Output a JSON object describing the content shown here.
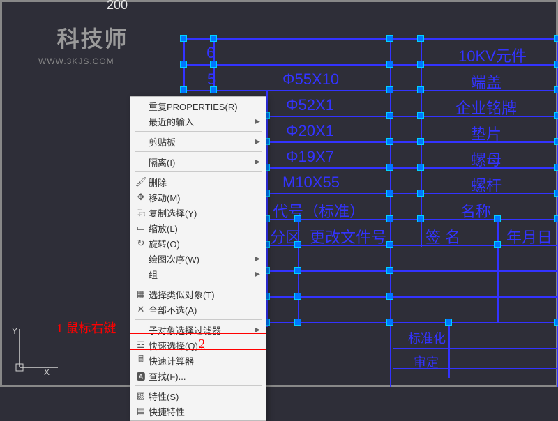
{
  "watermark": {
    "logo": "科技师",
    "url": "WWW.3KJS.COM"
  },
  "top_tick": "200",
  "menu": {
    "items": [
      {
        "label": "重复PROPERTIES(R)",
        "icon": "",
        "sub": false
      },
      {
        "label": "最近的输入",
        "icon": "",
        "sub": true
      },
      {
        "sep": true
      },
      {
        "label": "剪贴板",
        "icon": "",
        "sub": true
      },
      {
        "sep": true
      },
      {
        "label": "隔离(I)",
        "icon": "",
        "sub": true
      },
      {
        "sep": true
      },
      {
        "label": "删除",
        "icon": "erase",
        "sub": false
      },
      {
        "label": "移动(M)",
        "icon": "move",
        "sub": false
      },
      {
        "label": "复制选择(Y)",
        "icon": "copy",
        "sub": false
      },
      {
        "label": "缩放(L)",
        "icon": "scale",
        "sub": false
      },
      {
        "label": "旋转(O)",
        "icon": "rotate",
        "sub": false
      },
      {
        "label": "绘图次序(W)",
        "icon": "",
        "sub": true
      },
      {
        "label": "组",
        "icon": "",
        "sub": true
      },
      {
        "sep": true
      },
      {
        "label": "选择类似对象(T)",
        "icon": "selsim",
        "sub": false
      },
      {
        "label": "全部不选(A)",
        "icon": "desel",
        "sub": false
      },
      {
        "sep": true
      },
      {
        "label": "子对象选择过滤器",
        "icon": "",
        "sub": true
      },
      {
        "label": "快速选择(Q)...",
        "icon": "qsel",
        "sub": false
      },
      {
        "label": "快速计算器",
        "icon": "calc",
        "sub": false
      },
      {
        "label": "查找(F)...",
        "icon": "find",
        "sub": false
      },
      {
        "sep": true
      },
      {
        "label": "特性(S)",
        "icon": "prop",
        "sub": false
      },
      {
        "label": "快捷特性",
        "icon": "qprop",
        "sub": false
      }
    ]
  },
  "table": {
    "rows": [
      {
        "c1": "6",
        "c2": "",
        "c3": "10KV元件"
      },
      {
        "c1": "5",
        "c2": "Φ55X10",
        "c3": "端盖"
      },
      {
        "c1": "",
        "c2": "Φ52X1",
        "c3": "企业铭牌"
      },
      {
        "c1": "",
        "c2": "Φ20X1",
        "c3": "垫片"
      },
      {
        "c1": "",
        "c2": "Φ19X7",
        "c3": "螺母"
      },
      {
        "c1": "",
        "c2": "M10X55",
        "c3": "螺杆"
      },
      {
        "c1": "",
        "c2": "代号（标准）",
        "c3": "名称"
      }
    ],
    "bottom": {
      "h1": "分区",
      "h2": "更改文件号",
      "h3": "签 名",
      "h4": "年月日",
      "b1": "标准化",
      "b2": "审定"
    }
  },
  "annotations": {
    "a1": "1 鼠标右键",
    "a2": "2"
  },
  "ucs": {
    "x": "X",
    "y": "Y"
  }
}
